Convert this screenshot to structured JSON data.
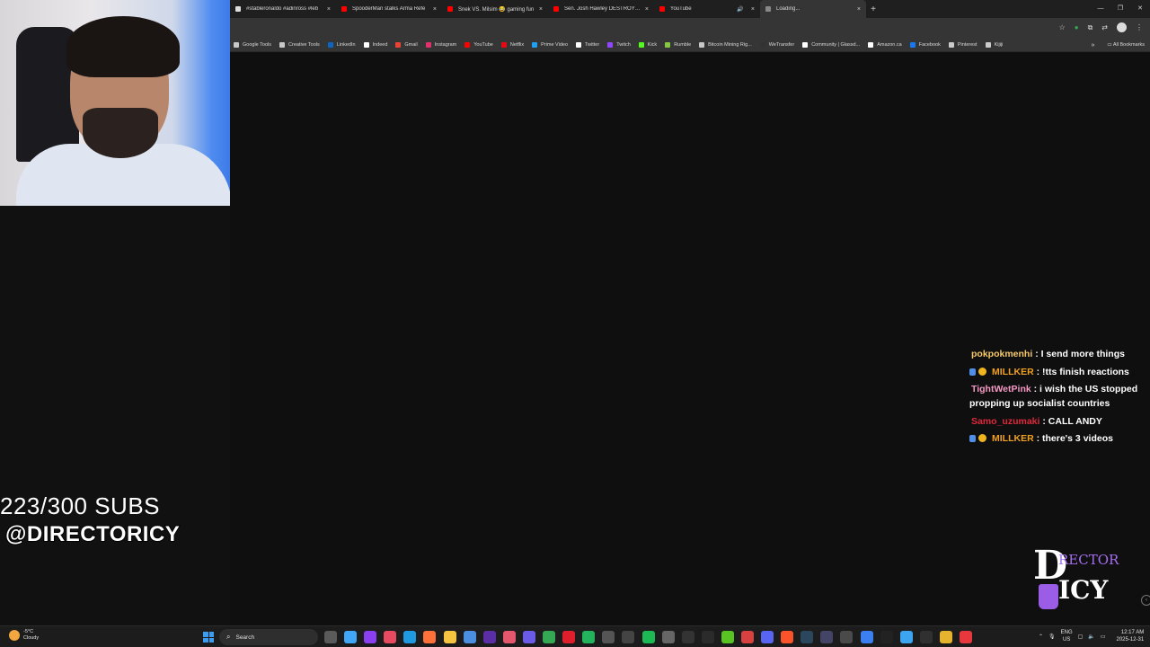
{
  "browser": {
    "tabs": [
      {
        "title": "#stableronaldo #adinross #leb",
        "favicon_color": "#dddddd",
        "icon": "tiktok-icon"
      },
      {
        "title": "SpooderMan stalks Arma Refe",
        "favicon_color": "#ff0000",
        "icon": "youtube-icon"
      },
      {
        "title": "Snek VS. Milsim 😂 gaming fun",
        "favicon_color": "#ff0000",
        "icon": "youtube-icon"
      },
      {
        "title": "Sen. Josh Hawley DESTROYS C",
        "favicon_color": "#ff0000",
        "icon": "youtube-icon"
      },
      {
        "title": "YouTube",
        "favicon_color": "#ff0000",
        "icon": "youtube-icon"
      },
      {
        "title": "Loading...",
        "favicon_color": "#888888",
        "icon": "loading-spinner-icon"
      }
    ],
    "window_controls": [
      "—",
      "❐",
      "✕"
    ],
    "bookmarks": [
      {
        "label": "Google Tools",
        "color": "#c8c8c8"
      },
      {
        "label": "Creative Tools",
        "color": "#c8c8c8"
      },
      {
        "label": "LinkedIn",
        "color": "#0a66c2"
      },
      {
        "label": "Indeed",
        "color": "#ffffff"
      },
      {
        "label": "Gmail",
        "color": "#ea4335"
      },
      {
        "label": "Instagram",
        "color": "#e1306c"
      },
      {
        "label": "YouTube",
        "color": "#ff0000"
      },
      {
        "label": "Netflix",
        "color": "#e50914"
      },
      {
        "label": "Prime Video",
        "color": "#1f9ff0"
      },
      {
        "label": "Twitter",
        "color": "#ffffff"
      },
      {
        "label": "Twitch",
        "color": "#9146ff"
      },
      {
        "label": "Kick",
        "color": "#53fc18"
      },
      {
        "label": "Rumble",
        "color": "#85c742"
      },
      {
        "label": "Bitcoin Mining Rig...",
        "color": "#c8c8c8"
      },
      {
        "label": "WeTransfer",
        "color": "#333333"
      },
      {
        "label": "Community | Glassd...",
        "color": "#ffffff"
      },
      {
        "label": "Amazon.ca",
        "color": "#ffffff"
      },
      {
        "label": "Facebook",
        "color": "#1877f2"
      },
      {
        "label": "Pinterest",
        "color": "#cccccc"
      },
      {
        "label": "Kijiji",
        "color": "#cccccc"
      }
    ],
    "all_bookmarks": "All Bookmarks"
  },
  "overlay": {
    "subs": "223/300 SUBS",
    "handle": "@DIRECTORICY",
    "logo_top": "RECTOR",
    "logo_big": "D",
    "logo_bottom": "ICY"
  },
  "chat": [
    {
      "user": "pokpokmenhi",
      "user_color": "#f5c96a",
      "text": ": I send more things",
      "badges": 0
    },
    {
      "user": "MILLKER",
      "user_color": "#f0a020",
      "text": ": !tts finish reactions",
      "badges": 2
    },
    {
      "user": "TightWetPink",
      "user_color": "#f49ac2",
      "text": ": i wish the US stopped propping up socialist countries",
      "badges": 0
    },
    {
      "user": "Samo_uzumaki",
      "user_color": "#e0283c",
      "text": ": CALL ANDY",
      "badges": 0
    },
    {
      "user": "MILLKER",
      "user_color": "#f0a020",
      "text": ": there's 3 videos",
      "badges": 2
    }
  ],
  "taskbar": {
    "weather_temp": "-5°C",
    "weather_desc": "Cloudy",
    "search_label": "Search",
    "apps": [
      {
        "name": "task-view-icon",
        "color": "#5a5a5a"
      },
      {
        "name": "copilot-icon",
        "color": "#3fa7f5"
      },
      {
        "name": "app-purple-icon",
        "color": "#8a3ff0"
      },
      {
        "name": "app-n-icon",
        "color": "#e84a5f"
      },
      {
        "name": "edge-icon",
        "color": "#1f9ae0"
      },
      {
        "name": "firefox-icon",
        "color": "#ff7139"
      },
      {
        "name": "file-explorer-icon",
        "color": "#f5c542"
      },
      {
        "name": "app-box-icon",
        "color": "#4a8fe0"
      },
      {
        "name": "app-m-icon",
        "color": "#5b2ea6"
      },
      {
        "name": "app-shield-icon",
        "color": "#e5576c"
      },
      {
        "name": "app-mail-icon",
        "color": "#6b5ce7"
      },
      {
        "name": "chrome-icon",
        "color": "#34a853"
      },
      {
        "name": "opera-icon",
        "color": "#e01f2c"
      },
      {
        "name": "app-g-icon",
        "color": "#22b35c"
      },
      {
        "name": "app-circle-icon",
        "color": "#555555"
      },
      {
        "name": "app-dots-icon",
        "color": "#444444"
      },
      {
        "name": "spotify-icon",
        "color": "#1db954"
      },
      {
        "name": "app-ring-icon",
        "color": "#666666"
      },
      {
        "name": "capcut-icon",
        "color": "#333333"
      },
      {
        "name": "app-cmd-icon",
        "color": "#2b2b2b"
      },
      {
        "name": "app-m2-icon",
        "color": "#58c322"
      },
      {
        "name": "app-red-icon",
        "color": "#d94040"
      },
      {
        "name": "discord-icon",
        "color": "#5865f2"
      },
      {
        "name": "brave-icon",
        "color": "#fb542b"
      },
      {
        "name": "steam-icon",
        "color": "#2a475e"
      },
      {
        "name": "obs-icon",
        "color": "#444466"
      },
      {
        "name": "app-grid-icon",
        "color": "#4a4a4a"
      },
      {
        "name": "app-blue-icon",
        "color": "#3c7ff0"
      },
      {
        "name": "x-icon",
        "color": "#222222"
      },
      {
        "name": "app-globe-icon",
        "color": "#3da5f0"
      },
      {
        "name": "app-dark-icon",
        "color": "#303030"
      },
      {
        "name": "app-yellow-icon",
        "color": "#e6b32e"
      },
      {
        "name": "app-last-icon",
        "color": "#e8383d"
      }
    ],
    "lang_top": "ENG",
    "lang_bottom": "US",
    "time": "12:17 AM",
    "date": "2025-12-31"
  }
}
